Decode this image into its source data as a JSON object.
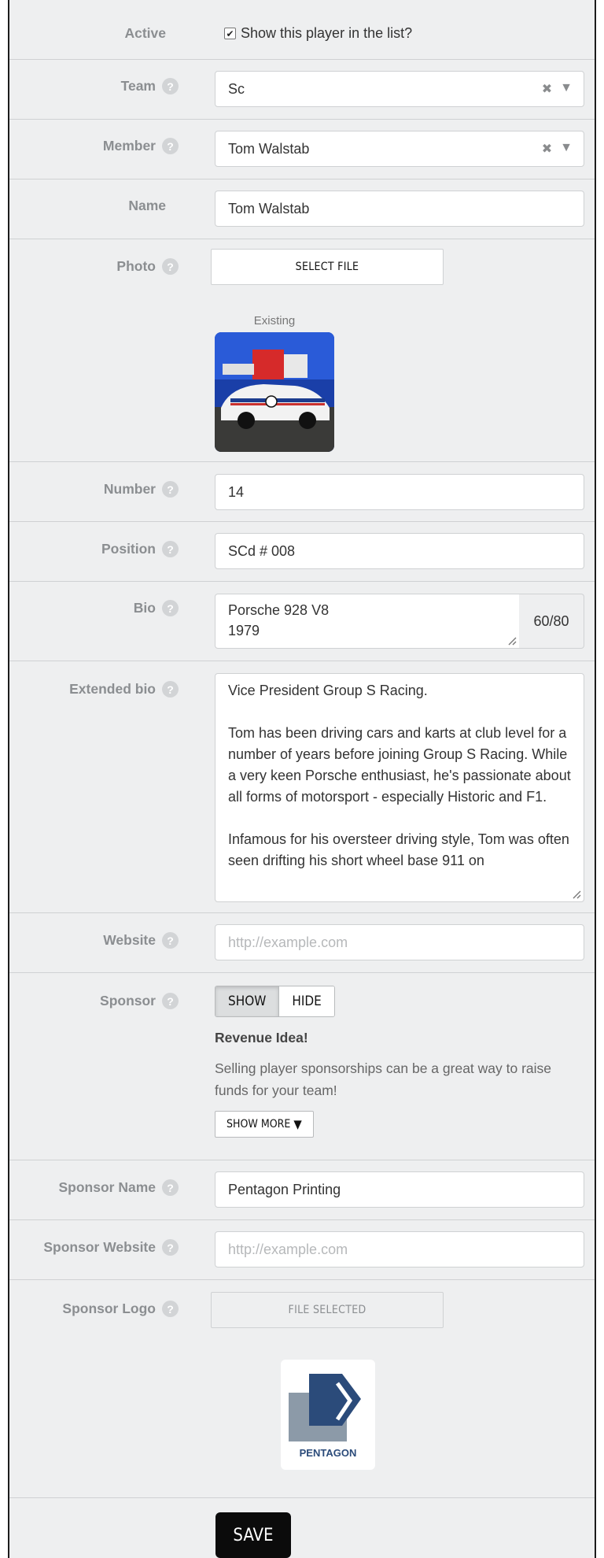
{
  "active": {
    "label": "Active",
    "checkbox_label": "Show this player in the list?",
    "checked": true
  },
  "team": {
    "label": "Team",
    "value": "Sc"
  },
  "member": {
    "label": "Member",
    "value": "Tom Walstab"
  },
  "name": {
    "label": "Name",
    "value": "Tom Walstab"
  },
  "photo": {
    "label": "Photo",
    "button": "SELECT FILE",
    "existing_caption": "Existing"
  },
  "number": {
    "label": "Number",
    "value": "14"
  },
  "position": {
    "label": "Position",
    "value": "SCd # 008"
  },
  "bio": {
    "label": "Bio",
    "line1": "Porsche 928 V8",
    "line2": "1979",
    "counter": "60/80"
  },
  "extended_bio": {
    "label": "Extended bio",
    "p1": "Vice President Group S Racing.",
    "p2": "Tom has been driving cars and karts at club level for a number of years before joining Group S Racing. While a very keen Porsche enthusiast, he's passionate about all forms of motorsport - especially Historic and F1.",
    "p3": "Infamous for his oversteer driving style, Tom was often seen drifting his short wheel base 911 on"
  },
  "website": {
    "label": "Website",
    "placeholder": "http://example.com"
  },
  "sponsor": {
    "label": "Sponsor",
    "show": "SHOW",
    "hide": "HIDE",
    "revenue_title": "Revenue Idea!",
    "revenue_text": "Selling player sponsorships can be a great way to raise funds for your team!",
    "show_more": "SHOW MORE"
  },
  "sponsor_name": {
    "label": "Sponsor Name",
    "value": "Pentagon Printing"
  },
  "sponsor_website": {
    "label": "Sponsor Website",
    "placeholder": "http://example.com"
  },
  "sponsor_logo": {
    "label": "Sponsor Logo",
    "button": "FILE SELECTED",
    "logo_text": "PENTAGON"
  },
  "save": {
    "label": "SAVE"
  },
  "colors": {
    "background": "#eeeff0",
    "label": "#8b8e91",
    "save_bg": "#0b0b0b",
    "logo_blue": "#2b4b7a"
  }
}
